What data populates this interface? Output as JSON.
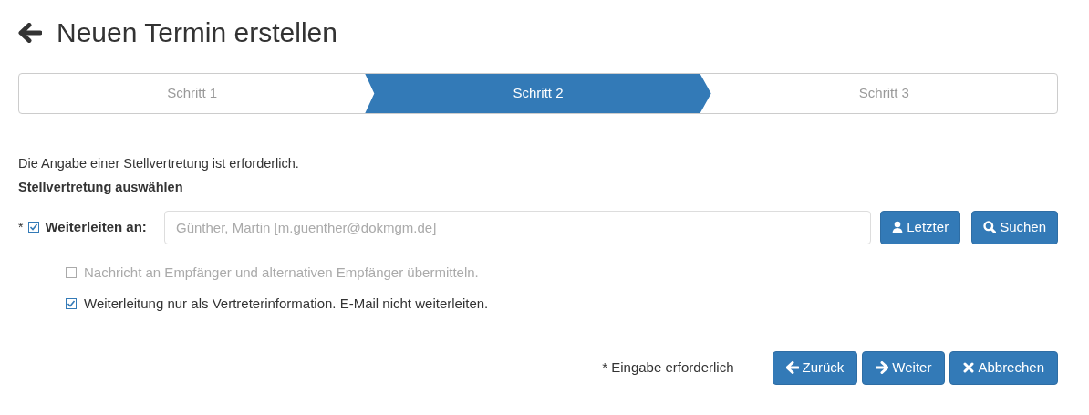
{
  "title": "Neuen Termin erstellen",
  "steps": [
    {
      "label": "Schritt 1",
      "selected": false
    },
    {
      "label": "Schritt 2",
      "selected": true
    },
    {
      "label": "Schritt 3",
      "selected": false
    }
  ],
  "info": "Die Angabe einer Stellvertretung ist erforderlich.",
  "section_title": "Stellvertretung auswählen",
  "forward": {
    "required_mark": "*",
    "checked": true,
    "label": "Weiterleiten an:",
    "placeholder": "Günther, Martin [m.guenther@dokmgm.de]",
    "buttons": [
      {
        "label": "Letzter"
      },
      {
        "label": "Suchen"
      }
    ]
  },
  "options": [
    {
      "label": "Nachricht an Empfänger und alternativen Empfänger übermitteln.",
      "checked": false,
      "disabled": true
    },
    {
      "label": "Weiterleitung nur als Vertreterinformation. E-Mail nicht weiterleiten.",
      "checked": true,
      "disabled": false
    }
  ],
  "required_note": "* Eingabe erforderlich",
  "footer_buttons": [
    {
      "label": "Zurück"
    },
    {
      "label": "Weiter"
    },
    {
      "label": "Abbrechen"
    }
  ]
}
